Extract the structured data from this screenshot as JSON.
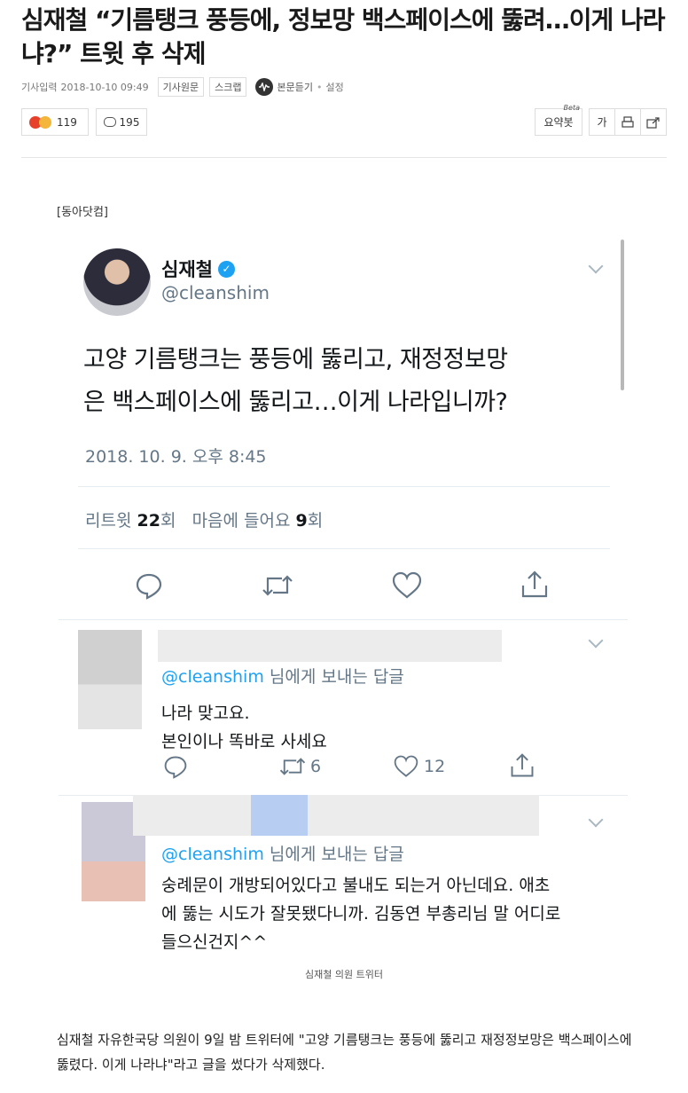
{
  "article": {
    "headline": "심재철 “기름탱크 풍등에, 정보망 백스페이스에 뚫려…이게 나라냐?” 트윗 후 삭제",
    "date_label": "기사입력",
    "date": "2018-10-10 09:49",
    "original_button": "기사원문",
    "scrap_button": "스크랩",
    "listen_label": "본문듣기",
    "settings_label": "설정",
    "reaction_count": "119",
    "comment_count": "195",
    "summary_label": "요약봇",
    "summary_beta": "Beta",
    "font_label": "가",
    "source_tag": "[동아닷컴]",
    "caption": "심재철 의원 트위터",
    "body": "심재철 자유한국당 의원이 9일 밤 트위터에 \"고양 기름탱크는 풍등에 뚫리고 재정정보망은 백스페이스에 뚫렸다. 이게 나라냐\"라고 글을 썼다가 삭제했다."
  },
  "tweet": {
    "name": "심재철",
    "handle": "@cleanshim",
    "text_line1": "고양 기름탱크는 풍등에 뚫리고, 재정정보망",
    "text_line2": "은 백스페이스에 뚫리고…이게 나라입니까?",
    "time": "2018. 10. 9. 오후 8:45",
    "retweets_label": "리트윗",
    "retweets_count": "22",
    "retweets_unit": "회",
    "likes_label": "마음에 들어요",
    "likes_count": "9",
    "likes_unit": "회"
  },
  "replies": [
    {
      "reply_handle": "@cleanshim",
      "reply_suffix": " 님에게 보내는 답글",
      "line1": "나라 맞고요.",
      "line2": "본인이나 똑바로 사세요",
      "retweets": "6",
      "likes": "12"
    },
    {
      "reply_handle": "@cleanshim",
      "reply_suffix": " 님에게 보내는 답글",
      "line1": "숭례문이 개방되어있다고 불내도 되는거 아닌데요. 애초",
      "line2": "에 뚫는 시도가 잘못됐다니까. 김동연 부총리님 말 어디로",
      "line3": "들으신건지^^"
    }
  ],
  "icons": {
    "verified": "verified-badge-icon",
    "reply": "reply-icon",
    "retweet": "retweet-icon",
    "like": "heart-icon",
    "share": "share-icon",
    "more": "chevron-down-icon"
  },
  "colors": {
    "twitter_blue": "#1da1f2",
    "muted_text": "#657786",
    "divider": "#e6ecf0"
  }
}
